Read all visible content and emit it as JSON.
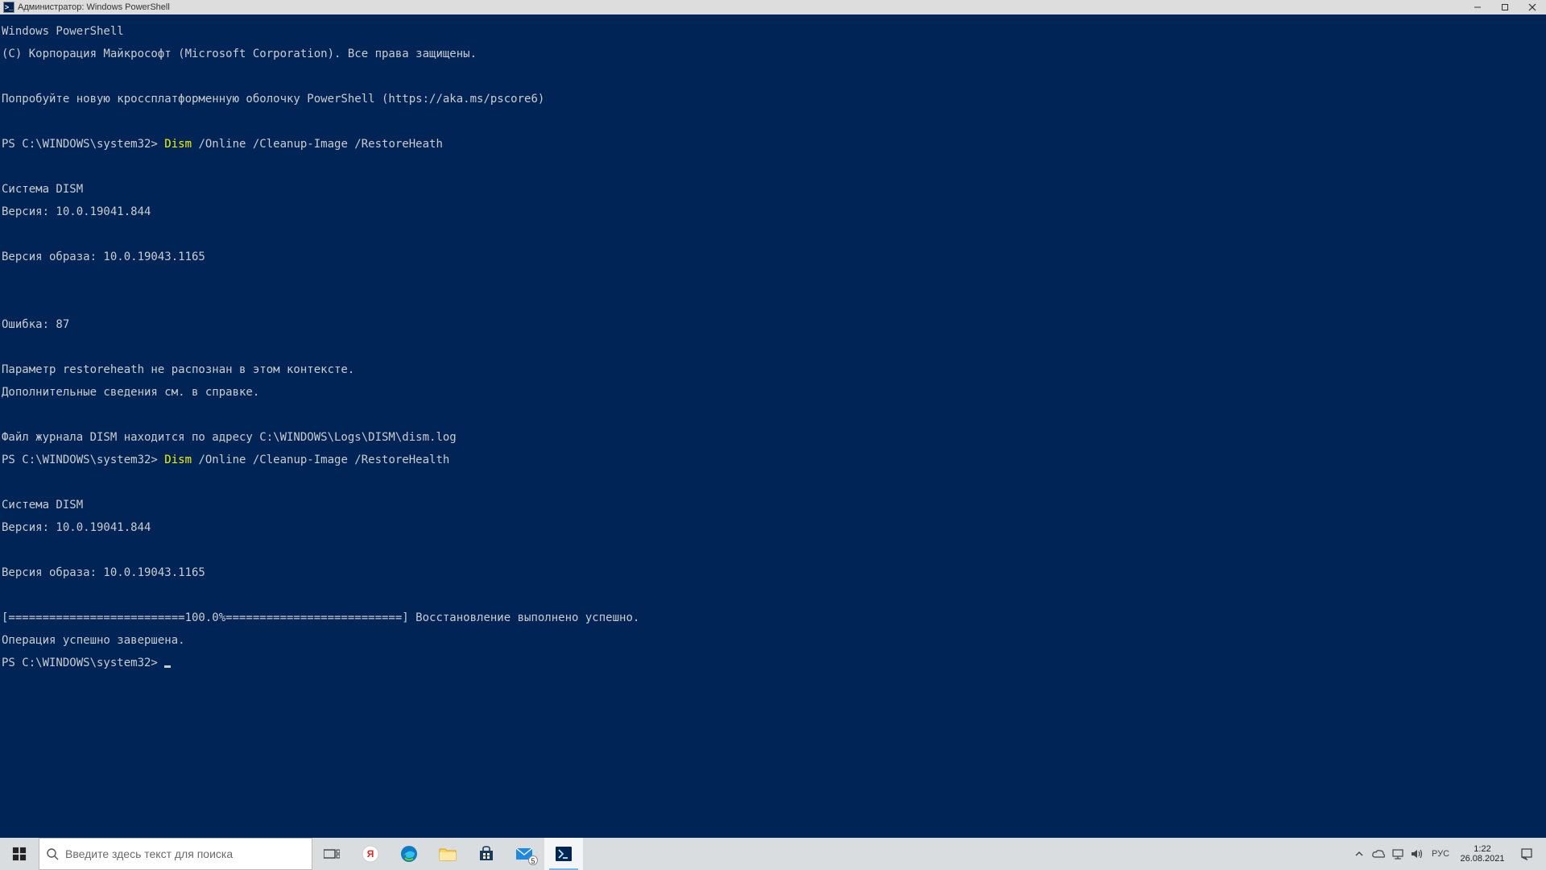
{
  "window": {
    "title": "Администратор: Windows PowerShell"
  },
  "terminal": {
    "header1": "Windows PowerShell",
    "header2": "(C) Корпорация Майкрософт (Microsoft Corporation). Все права защищены.",
    "tryNew": "Попробуйте новую кроссплатформенную оболочку PowerShell (https://aka.ms/pscore6)",
    "prompt1_prefix": "PS C:\\WINDOWS\\system32> ",
    "prompt1_cmd": "Dism",
    "prompt1_args": " /Online /Cleanup-Image /RestoreHeath",
    "dism_sys": "Cистема DISM",
    "dism_ver": "Версия: 10.0.19041.844",
    "img_ver": "Версия образа: 10.0.19043.1165",
    "error_line": "Ошибка: 87",
    "err_msg1": "Параметр restoreheath не распознан в этом контексте.",
    "err_msg2": "Дополнительные сведения см. в справке.",
    "log_line": "Файл журнала DISM находится по адресу C:\\WINDOWS\\Logs\\DISM\\dism.log",
    "prompt2_prefix": "PS C:\\WINDOWS\\system32> ",
    "prompt2_cmd": "Dism",
    "prompt2_args": " /Online /Cleanup-Image /RestoreHealth",
    "dism_sys2": "Cистема DISM",
    "dism_ver2": "Версия: 10.0.19041.844",
    "img_ver2": "Версия образа: 10.0.19043.1165",
    "progress": "[==========================100.0%==========================] Восстановление выполнено успешно.",
    "done": "Операция успешно завершена.",
    "prompt3": "PS C:\\WINDOWS\\system32> "
  },
  "taskbar": {
    "search_placeholder": "Введите здесь текст для поиска",
    "mail_badge": "5",
    "lang": "РУС",
    "time": "1:22",
    "date": "26.08.2021"
  }
}
